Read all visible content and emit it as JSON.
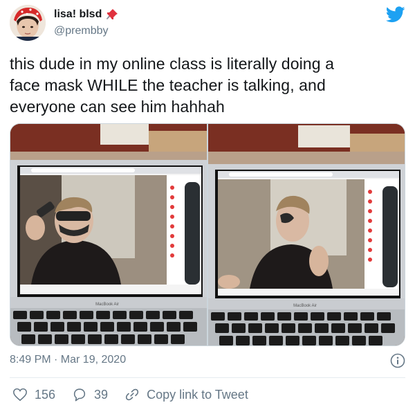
{
  "author": {
    "display_name": "lisa! blsd",
    "pin_emoji": "📌",
    "handle": "@prembby"
  },
  "tweet": {
    "text_lines": [
      "this dude in my online class is literally doing a",
      "face mask WHILE the teacher is talking, and",
      "everyone can see him hahhah"
    ],
    "timestamp": "8:49 PM · Mar 19, 2020"
  },
  "media": {
    "photos": [
      {
        "laptop_label": "MacBook Air"
      },
      {
        "laptop_label": "MacBook Air"
      }
    ]
  },
  "actions": {
    "likes": "156",
    "replies": "39",
    "share_label": "Copy link to Tweet"
  },
  "colors": {
    "twitter_blue": "#1da1f2",
    "secondary_text": "#657786",
    "primary_text": "#14171a"
  },
  "icons": [
    "twitter-bird-icon",
    "pin-icon",
    "info-icon",
    "heart-icon",
    "reply-icon",
    "link-icon"
  ]
}
